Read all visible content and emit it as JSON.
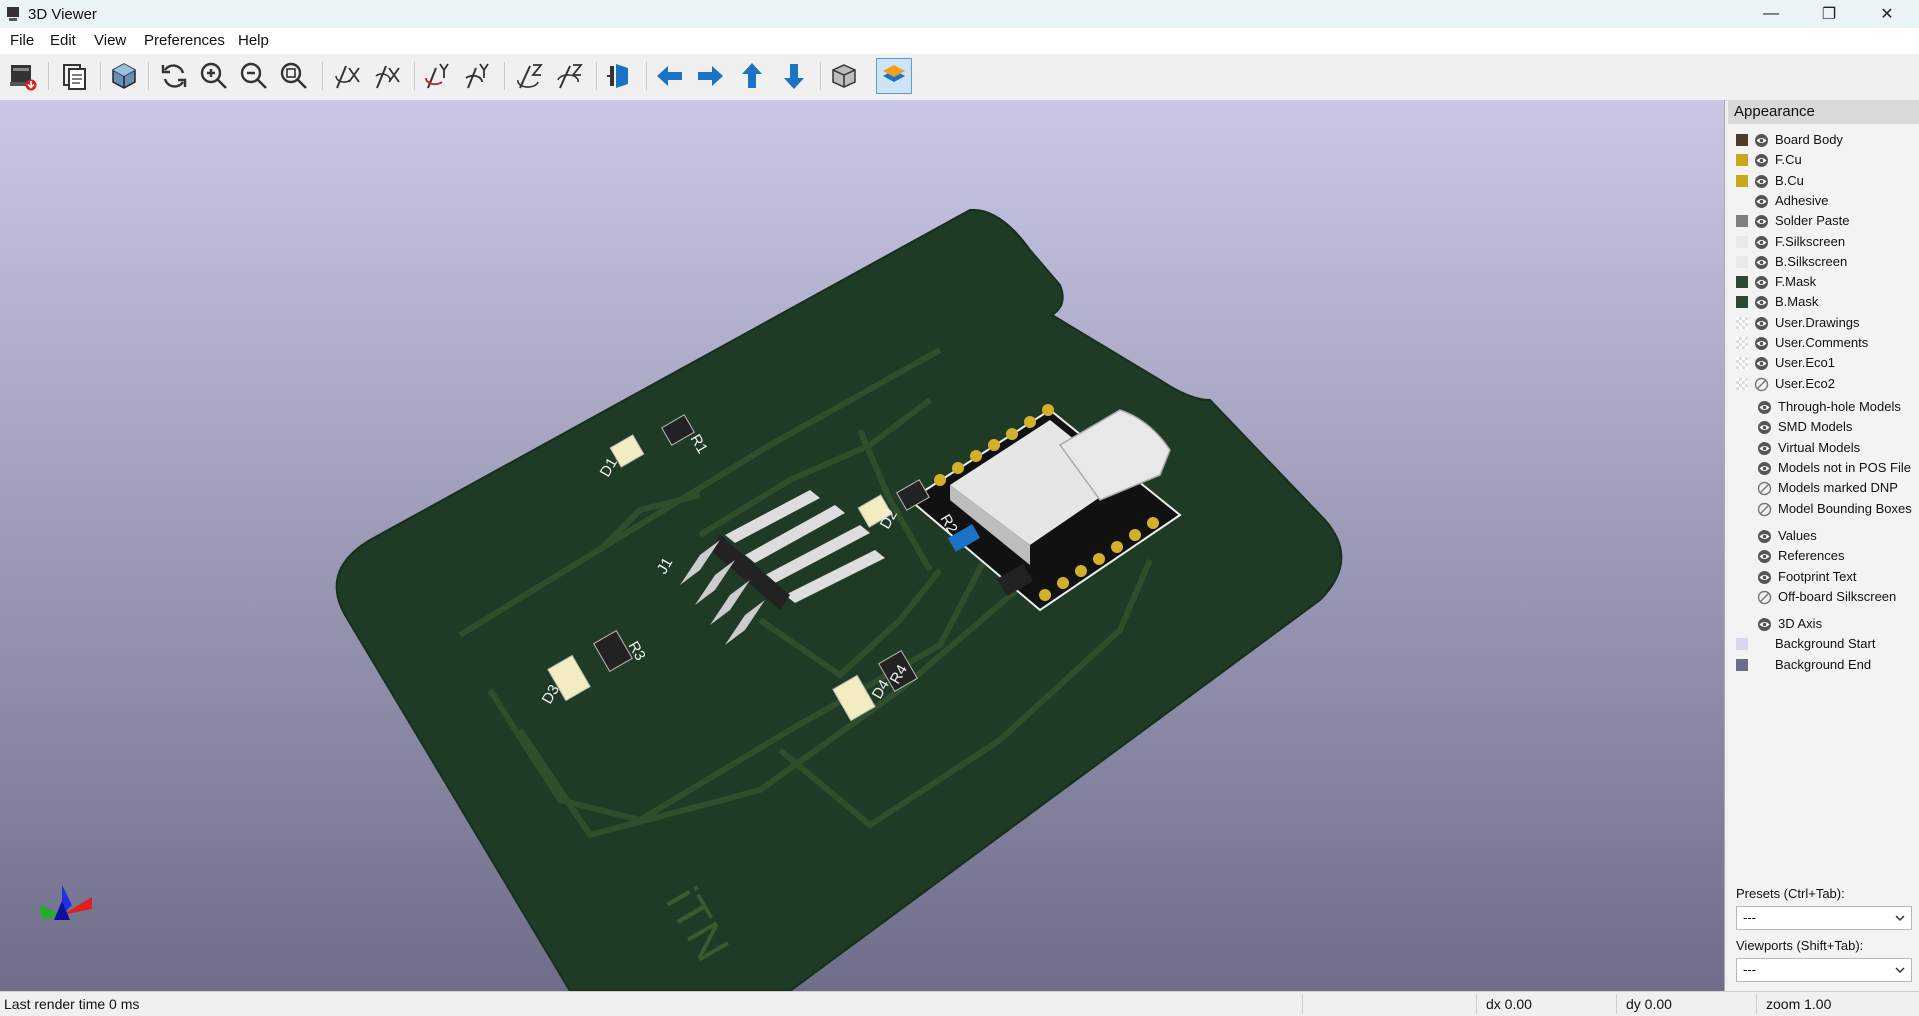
{
  "window": {
    "title": "3D Viewer",
    "controls": {
      "minimize": "—",
      "maximize": "❐",
      "close": "✕"
    }
  },
  "menu": [
    "File",
    "Edit",
    "View",
    "Preferences",
    "Help"
  ],
  "toolbar": {
    "buttons": [
      {
        "name": "export-image",
        "icon": "camera-export-icon"
      },
      {
        "name": "copy-clipboard",
        "icon": "clipboard-icon"
      },
      {
        "name": "raytracing",
        "icon": "render-cube-icon"
      },
      {
        "name": "reload",
        "icon": "refresh-icon"
      },
      {
        "name": "zoom-in",
        "icon": "zoom-in-icon"
      },
      {
        "name": "zoom-out",
        "icon": "zoom-out-icon"
      },
      {
        "name": "zoom-fit",
        "icon": "zoom-fit-icon"
      },
      {
        "name": "rotate-x-cw",
        "icon": "rotate-x-cw-icon"
      },
      {
        "name": "rotate-x-ccw",
        "icon": "rotate-x-ccw-icon"
      },
      {
        "name": "rotate-y-cw",
        "icon": "rotate-y-cw-icon"
      },
      {
        "name": "rotate-y-ccw",
        "icon": "rotate-y-ccw-icon"
      },
      {
        "name": "rotate-z-cw",
        "icon": "rotate-z-cw-icon"
      },
      {
        "name": "rotate-z-ccw",
        "icon": "rotate-z-ccw-icon"
      },
      {
        "name": "flip-board",
        "icon": "flip-board-icon"
      },
      {
        "name": "pan-left",
        "icon": "arrow-left-icon"
      },
      {
        "name": "pan-right",
        "icon": "arrow-right-icon"
      },
      {
        "name": "pan-up",
        "icon": "arrow-up-icon"
      },
      {
        "name": "pan-down",
        "icon": "arrow-down-icon"
      },
      {
        "name": "ortho-toggle",
        "icon": "ortho-cube-icon"
      },
      {
        "name": "layers-manager",
        "icon": "layers-icon"
      }
    ]
  },
  "colors": {
    "background_start": "#c8c8e6",
    "background_end": "#6e6e8a",
    "board_mask": "#1f3a25",
    "copper": "#c7a61c",
    "accent": "#1b73c6"
  },
  "pcb": {
    "designators": [
      "D1",
      "R1",
      "D2",
      "R2",
      "J1",
      "D3",
      "R3",
      "D4",
      "R4"
    ],
    "board_text": "iTN"
  },
  "appearance": {
    "title": "Appearance",
    "layers": [
      {
        "label": "Board Body",
        "color": "#4a3d2a",
        "visibility": "eye"
      },
      {
        "label": "F.Cu",
        "color": "#c9a81e",
        "visibility": "eye"
      },
      {
        "label": "B.Cu",
        "color": "#c9a81e",
        "visibility": "eye"
      },
      {
        "label": "Adhesive",
        "color": "",
        "visibility": "eye"
      },
      {
        "label": "Solder Paste",
        "color": "#808080",
        "visibility": "eye"
      },
      {
        "label": "F.Silkscreen",
        "color": "#e8e8e8",
        "visibility": "eye"
      },
      {
        "label": "B.Silkscreen",
        "color": "#e8e8e8",
        "visibility": "eye"
      },
      {
        "label": "F.Mask",
        "color": "#2c4a35",
        "visibility": "eye"
      },
      {
        "label": "B.Mask",
        "color": "#2c4a35",
        "visibility": "eye"
      },
      {
        "label": "User.Drawings",
        "color": "checker",
        "visibility": "eye"
      },
      {
        "label": "User.Comments",
        "color": "checker",
        "visibility": "eye"
      },
      {
        "label": "User.Eco1",
        "color": "checker",
        "visibility": "eye"
      },
      {
        "label": "User.Eco2",
        "color": "checker",
        "visibility": "hidden"
      }
    ],
    "models": [
      {
        "label": "Through-hole Models",
        "visibility": "eye"
      },
      {
        "label": "SMD Models",
        "visibility": "eye"
      },
      {
        "label": "Virtual Models",
        "visibility": "eye"
      },
      {
        "label": "Models not in POS File",
        "visibility": "eye"
      },
      {
        "label": "Models marked DNP",
        "visibility": "hidden"
      },
      {
        "label": "Model Bounding Boxes",
        "visibility": "hidden"
      }
    ],
    "text_items": [
      {
        "label": "Values",
        "visibility": "eye"
      },
      {
        "label": "References",
        "visibility": "eye"
      },
      {
        "label": "Footprint Text",
        "visibility": "eye"
      },
      {
        "label": "Off-board Silkscreen",
        "visibility": "hidden"
      }
    ],
    "misc": [
      {
        "label": "3D Axis",
        "visibility": "eye"
      },
      {
        "label": "Background Start",
        "color": "#d6d6ee"
      },
      {
        "label": "Background End",
        "color": "#6b6b8a"
      }
    ],
    "presets_label": "Presets (Ctrl+Tab):",
    "presets_value": "---",
    "viewports_label": "Viewports (Shift+Tab):",
    "viewports_value": "---"
  },
  "status": {
    "render_time": "Last render time 0 ms",
    "dx": "dx 0.00",
    "dy": "dy 0.00",
    "zoom": "zoom 1.00"
  }
}
